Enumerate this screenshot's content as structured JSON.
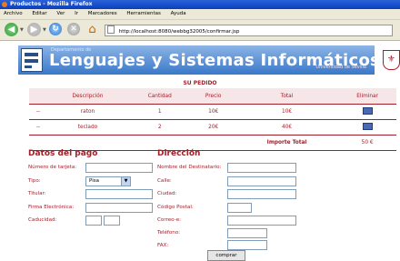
{
  "window": {
    "title": "Productos - Mozilla Firefox"
  },
  "menu": [
    "Archivo",
    "Editar",
    "Ver",
    "Ir",
    "Marcadores",
    "Herramientas",
    "Ayuda"
  ],
  "nav": {
    "url": "http://localhost:8080/webbg32005/confirmar.jsp"
  },
  "banner": {
    "dept": "Departamento de",
    "title": "Lenguajes y Sistemas Informáticos",
    "univ": "Universidad de Sevilla"
  },
  "order": {
    "title": "SU PEDIDO",
    "headers": [
      "Descripción",
      "Cantidad",
      "Precio",
      "Total",
      "Eliminar"
    ],
    "rows": [
      {
        "marker": "--",
        "desc": "raton",
        "qty": "1",
        "price": "10€",
        "total": "10€"
      },
      {
        "marker": "--",
        "desc": "teclado",
        "qty": "2",
        "price": "20€",
        "total": "40€"
      }
    ],
    "total_label": "Importe Total",
    "total_value": "50 €"
  },
  "payment": {
    "title": "Datos del pago",
    "card_label": "Número de tarjeta:",
    "type_label": "Tipo:",
    "type_value": "Pisa",
    "holder_label": "Titular:",
    "signature_label": "Firma Electrónica:",
    "expiry_label": "Caducidad:"
  },
  "address": {
    "title": "Dirección",
    "name_label": "Nombre del Destinatario:",
    "street_label": "Calle:",
    "city_label": "Ciudad:",
    "zip_label": "Código Postal:",
    "email_label": "Correo-e:",
    "phone_label": "Teléfono:",
    "fax_label": "FAX:"
  },
  "buy_button": "comprar"
}
